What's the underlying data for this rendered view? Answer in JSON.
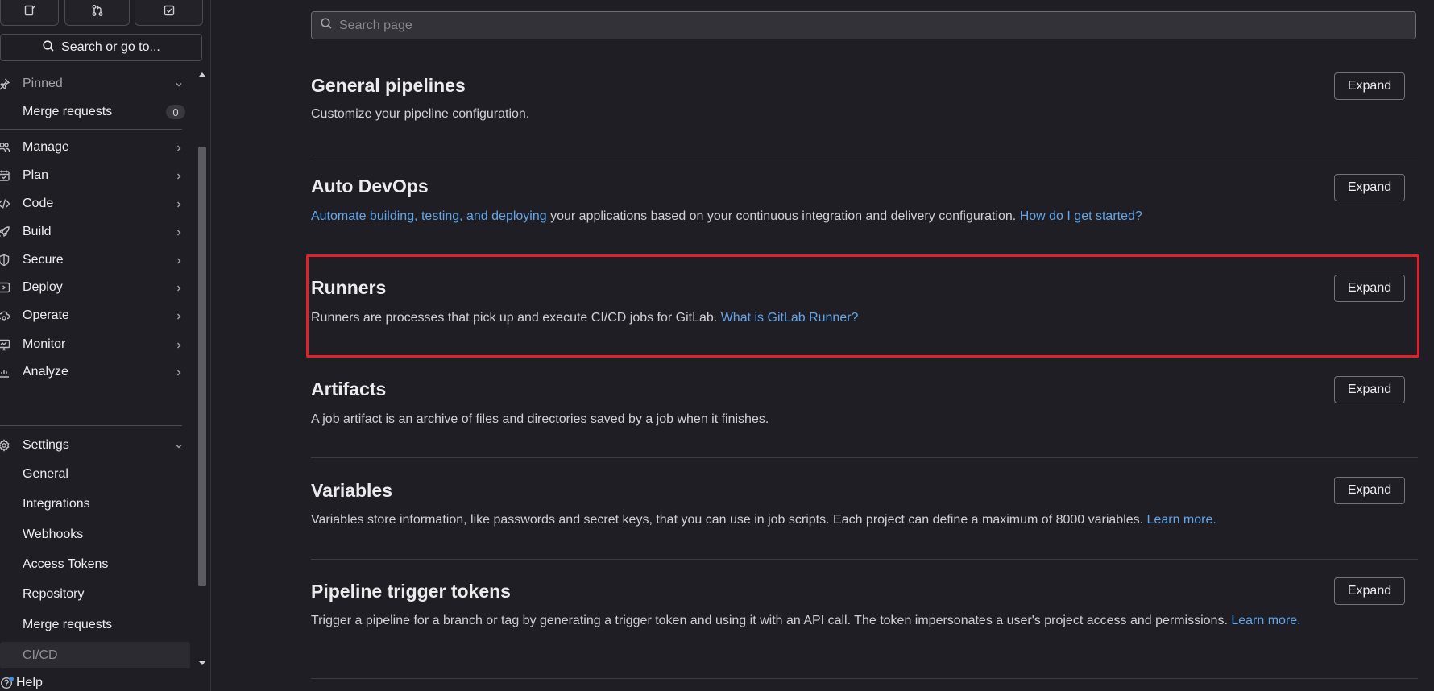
{
  "sidebar": {
    "top_tabs": [
      {
        "icon": "issues-icon"
      },
      {
        "icon": "merge-request-icon"
      },
      {
        "icon": "todo-icon"
      }
    ],
    "search_label": "Search or go to...",
    "pinned_label": "Pinned",
    "pinned_items": [
      {
        "label": "Merge requests",
        "count": "0"
      }
    ],
    "items": [
      {
        "label": "Manage",
        "icon": "users-icon"
      },
      {
        "label": "Plan",
        "icon": "calendar-icon"
      },
      {
        "label": "Code",
        "icon": "code-icon"
      },
      {
        "label": "Build",
        "icon": "rocket-icon"
      },
      {
        "label": "Secure",
        "icon": "shield-icon"
      },
      {
        "label": "Deploy",
        "icon": "deploy-icon"
      },
      {
        "label": "Operate",
        "icon": "cloud-gear-icon"
      },
      {
        "label": "Monitor",
        "icon": "monitor-icon"
      },
      {
        "label": "Analyze",
        "icon": "chart-icon"
      }
    ],
    "settings_label": "Settings",
    "settings_items": [
      {
        "label": "General"
      },
      {
        "label": "Integrations"
      },
      {
        "label": "Webhooks"
      },
      {
        "label": "Access Tokens"
      },
      {
        "label": "Repository"
      },
      {
        "label": "Merge requests"
      },
      {
        "label": "CI/CD"
      }
    ],
    "help_label": "Help"
  },
  "main": {
    "search_placeholder": "Search page",
    "expand_label": "Expand",
    "sections": {
      "general_pipelines": {
        "title": "General pipelines",
        "description": "Customize your pipeline configuration."
      },
      "auto_devops": {
        "title": "Auto DevOps",
        "link1": "Automate building, testing, and deploying",
        "text": " your applications based on your continuous integration and delivery configuration. ",
        "link2": "How do I get started?"
      },
      "runners": {
        "title": "Runners",
        "text": "Runners are processes that pick up and execute CI/CD jobs for GitLab. ",
        "link": "What is GitLab Runner?"
      },
      "artifacts": {
        "title": "Artifacts",
        "description": "A job artifact is an archive of files and directories saved by a job when it finishes."
      },
      "variables": {
        "title": "Variables",
        "text": "Variables store information, like passwords and secret keys, that you can use in job scripts. Each project can define a maximum of 8000 variables. ",
        "link": "Learn more."
      },
      "pipeline_trigger_tokens": {
        "title": "Pipeline trigger tokens",
        "text": "Trigger a pipeline for a branch or tag by generating a trigger token and using it with an API call. The token impersonates a user's project access and permissions. ",
        "link": "Learn more."
      }
    }
  },
  "colors": {
    "background": "#1f1e24",
    "link": "#63a6e9",
    "highlight": "#e0202a"
  }
}
